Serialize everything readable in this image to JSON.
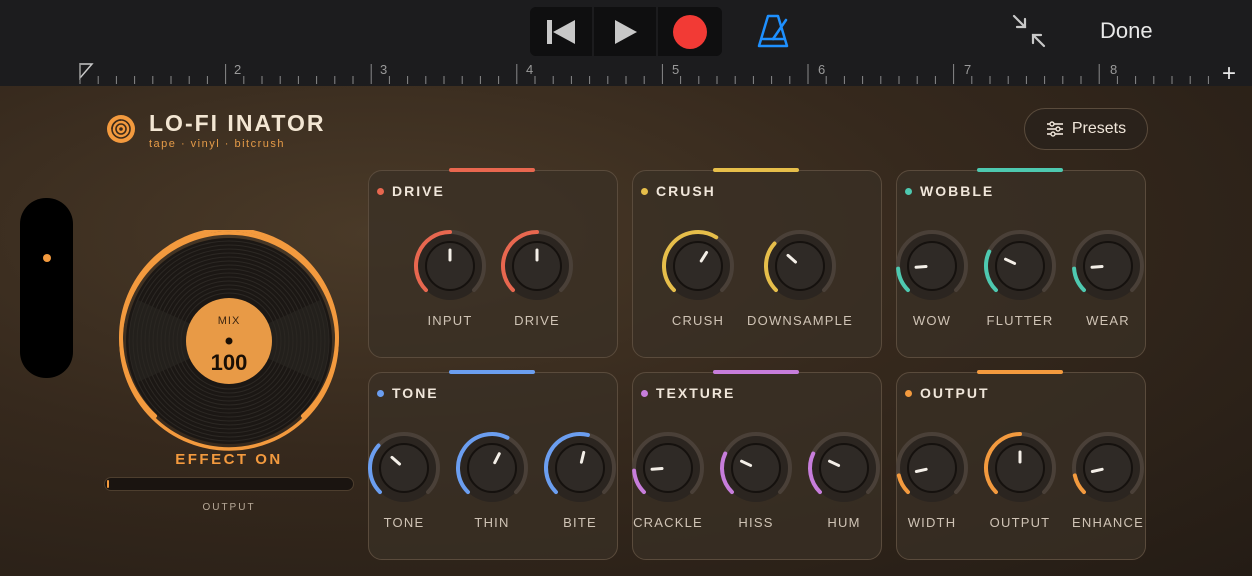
{
  "toolbar": {
    "transport": [
      "skip-back",
      "play",
      "record"
    ],
    "done_label": "Done",
    "icons": [
      "metronome-icon",
      "collapse-icon"
    ],
    "record_color": "#f23a35",
    "metronome_color": "#1e90ff"
  },
  "ruler": {
    "markers": [
      "2",
      "3",
      "4",
      "5",
      "6",
      "7",
      "8"
    ],
    "add_label": "+"
  },
  "brand": {
    "title": "LO-FI INATOR",
    "subtitle": "tape · vinyl · bitcrush",
    "accent": "#f39a3e"
  },
  "presets": {
    "label": "Presets"
  },
  "mix": {
    "label": "MIX",
    "value": "100",
    "status": "EFFECT ON",
    "output_label": "OUTPUT",
    "output_level": 0.01
  },
  "panels": [
    {
      "title": "DRIVE",
      "color": "#e8674f",
      "knobs": [
        {
          "label": "INPUT",
          "value": 0.5
        },
        {
          "label": "DRIVE",
          "value": 0.5
        }
      ]
    },
    {
      "title": "CRUSH",
      "color": "#e6be4a",
      "knobs": [
        {
          "label": "CRUSH",
          "value": 0.62
        },
        {
          "label": "DOWNSAMPLE",
          "value": 0.32
        }
      ]
    },
    {
      "title": "WOBBLE",
      "color": "#4ec9b0",
      "knobs": [
        {
          "label": "WOW",
          "value": 0.15
        },
        {
          "label": "FLUTTER",
          "value": 0.26
        },
        {
          "label": "WEAR",
          "value": 0.15
        }
      ]
    },
    {
      "title": "TONE",
      "color": "#6b9ef0",
      "knobs": [
        {
          "label": "TONE",
          "value": 0.32
        },
        {
          "label": "THIN",
          "value": 0.6
        },
        {
          "label": "BITE",
          "value": 0.55
        }
      ]
    },
    {
      "title": "TEXTURE",
      "color": "#c77ddb",
      "knobs": [
        {
          "label": "CRACKLE",
          "value": 0.15
        },
        {
          "label": "HISS",
          "value": 0.26
        },
        {
          "label": "HUM",
          "value": 0.26
        }
      ]
    },
    {
      "title": "OUTPUT",
      "color": "#f39a3e",
      "knobs": [
        {
          "label": "WIDTH",
          "value": 0.12
        },
        {
          "label": "OUTPUT",
          "value": 0.5
        },
        {
          "label": "ENHANCE",
          "value": 0.12
        }
      ]
    }
  ]
}
